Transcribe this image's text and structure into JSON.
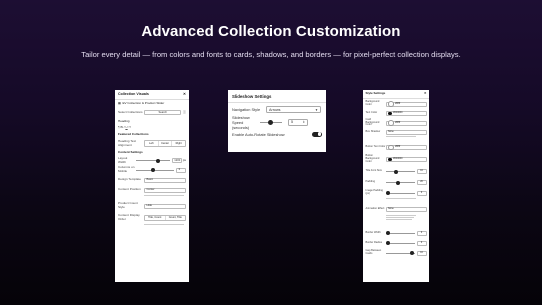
{
  "header": {
    "title": "Advanced Collection Customization",
    "subtitle": "Tailor every detail — from colors and fonts to cards, shadows, and borders — for pixel-perfect collection displays."
  },
  "panel_left": {
    "title": "Collection Visuals",
    "collection_name": "EV Collection & Product Slider",
    "select_collections_label": "Select Collections",
    "search_button": "Search",
    "heading_label": "Heading",
    "heading_value": "Featured Collections",
    "heading_text_alignment_label": "Heading Text Alignment",
    "alignment_options": [
      "Left",
      "Center",
      "Right"
    ],
    "content_settings_label": "Content Settings",
    "layout_width_label": "Layout Width",
    "layout_width_value": "1200",
    "layout_width_unit": "px",
    "columns_mobile_label": "Columns on Mobile",
    "columns_mobile_value": "3",
    "design_template_label": "Design Template",
    "design_template_value": "Basic",
    "content_position_label": "Content Position",
    "content_position_value": "Center",
    "product_count_label": "Product Count Style",
    "product_count_value": "Hide",
    "content_display_label": "Content Display Order",
    "content_display_options": [
      "Title, Count",
      "Count, Title"
    ]
  },
  "panel_center": {
    "title": "Slideshow Settings",
    "navigation_style_label": "Navigation Style",
    "navigation_style_value": "Arrows",
    "slideshow_speed_label": "Slideshow Speed (seconds)",
    "slideshow_speed_value": "5",
    "slideshow_speed_fraction": 0.35,
    "auto_rotate_label": "Enable Auto-Rotate Slideshow",
    "auto_rotate_on": true
  },
  "panel_right": {
    "title": "Style Settings",
    "background_color_label": "Background Color",
    "background_color_value": "#ffffff",
    "text_color_label": "Text Color",
    "text_color_value": "#000000",
    "card_background_label": "Card Background Color",
    "card_background_value": "#ffffff",
    "box_shadow_label": "Box Shadow",
    "box_shadow_value": "None",
    "button_text_color_label": "Button Text Color",
    "button_text_color_value": "#ffffff",
    "button_background_label": "Button Background Color",
    "button_background_value": "#000000",
    "font_size_label": "Title Font Size",
    "font_size_value": "16",
    "padding_label": "Padding",
    "padding_value": "20",
    "image_padding_label": "Image Padding (px)",
    "image_padding_value": "0",
    "animation_effect_label": "Animation Effect",
    "animation_effect_value": "None",
    "border_width_label": "Border Width",
    "border_width_value": "0",
    "border_radius_label": "Border Radius",
    "border_radius_value": "0",
    "gap_label": "Gap Between Cards",
    "gap_value": "16"
  }
}
